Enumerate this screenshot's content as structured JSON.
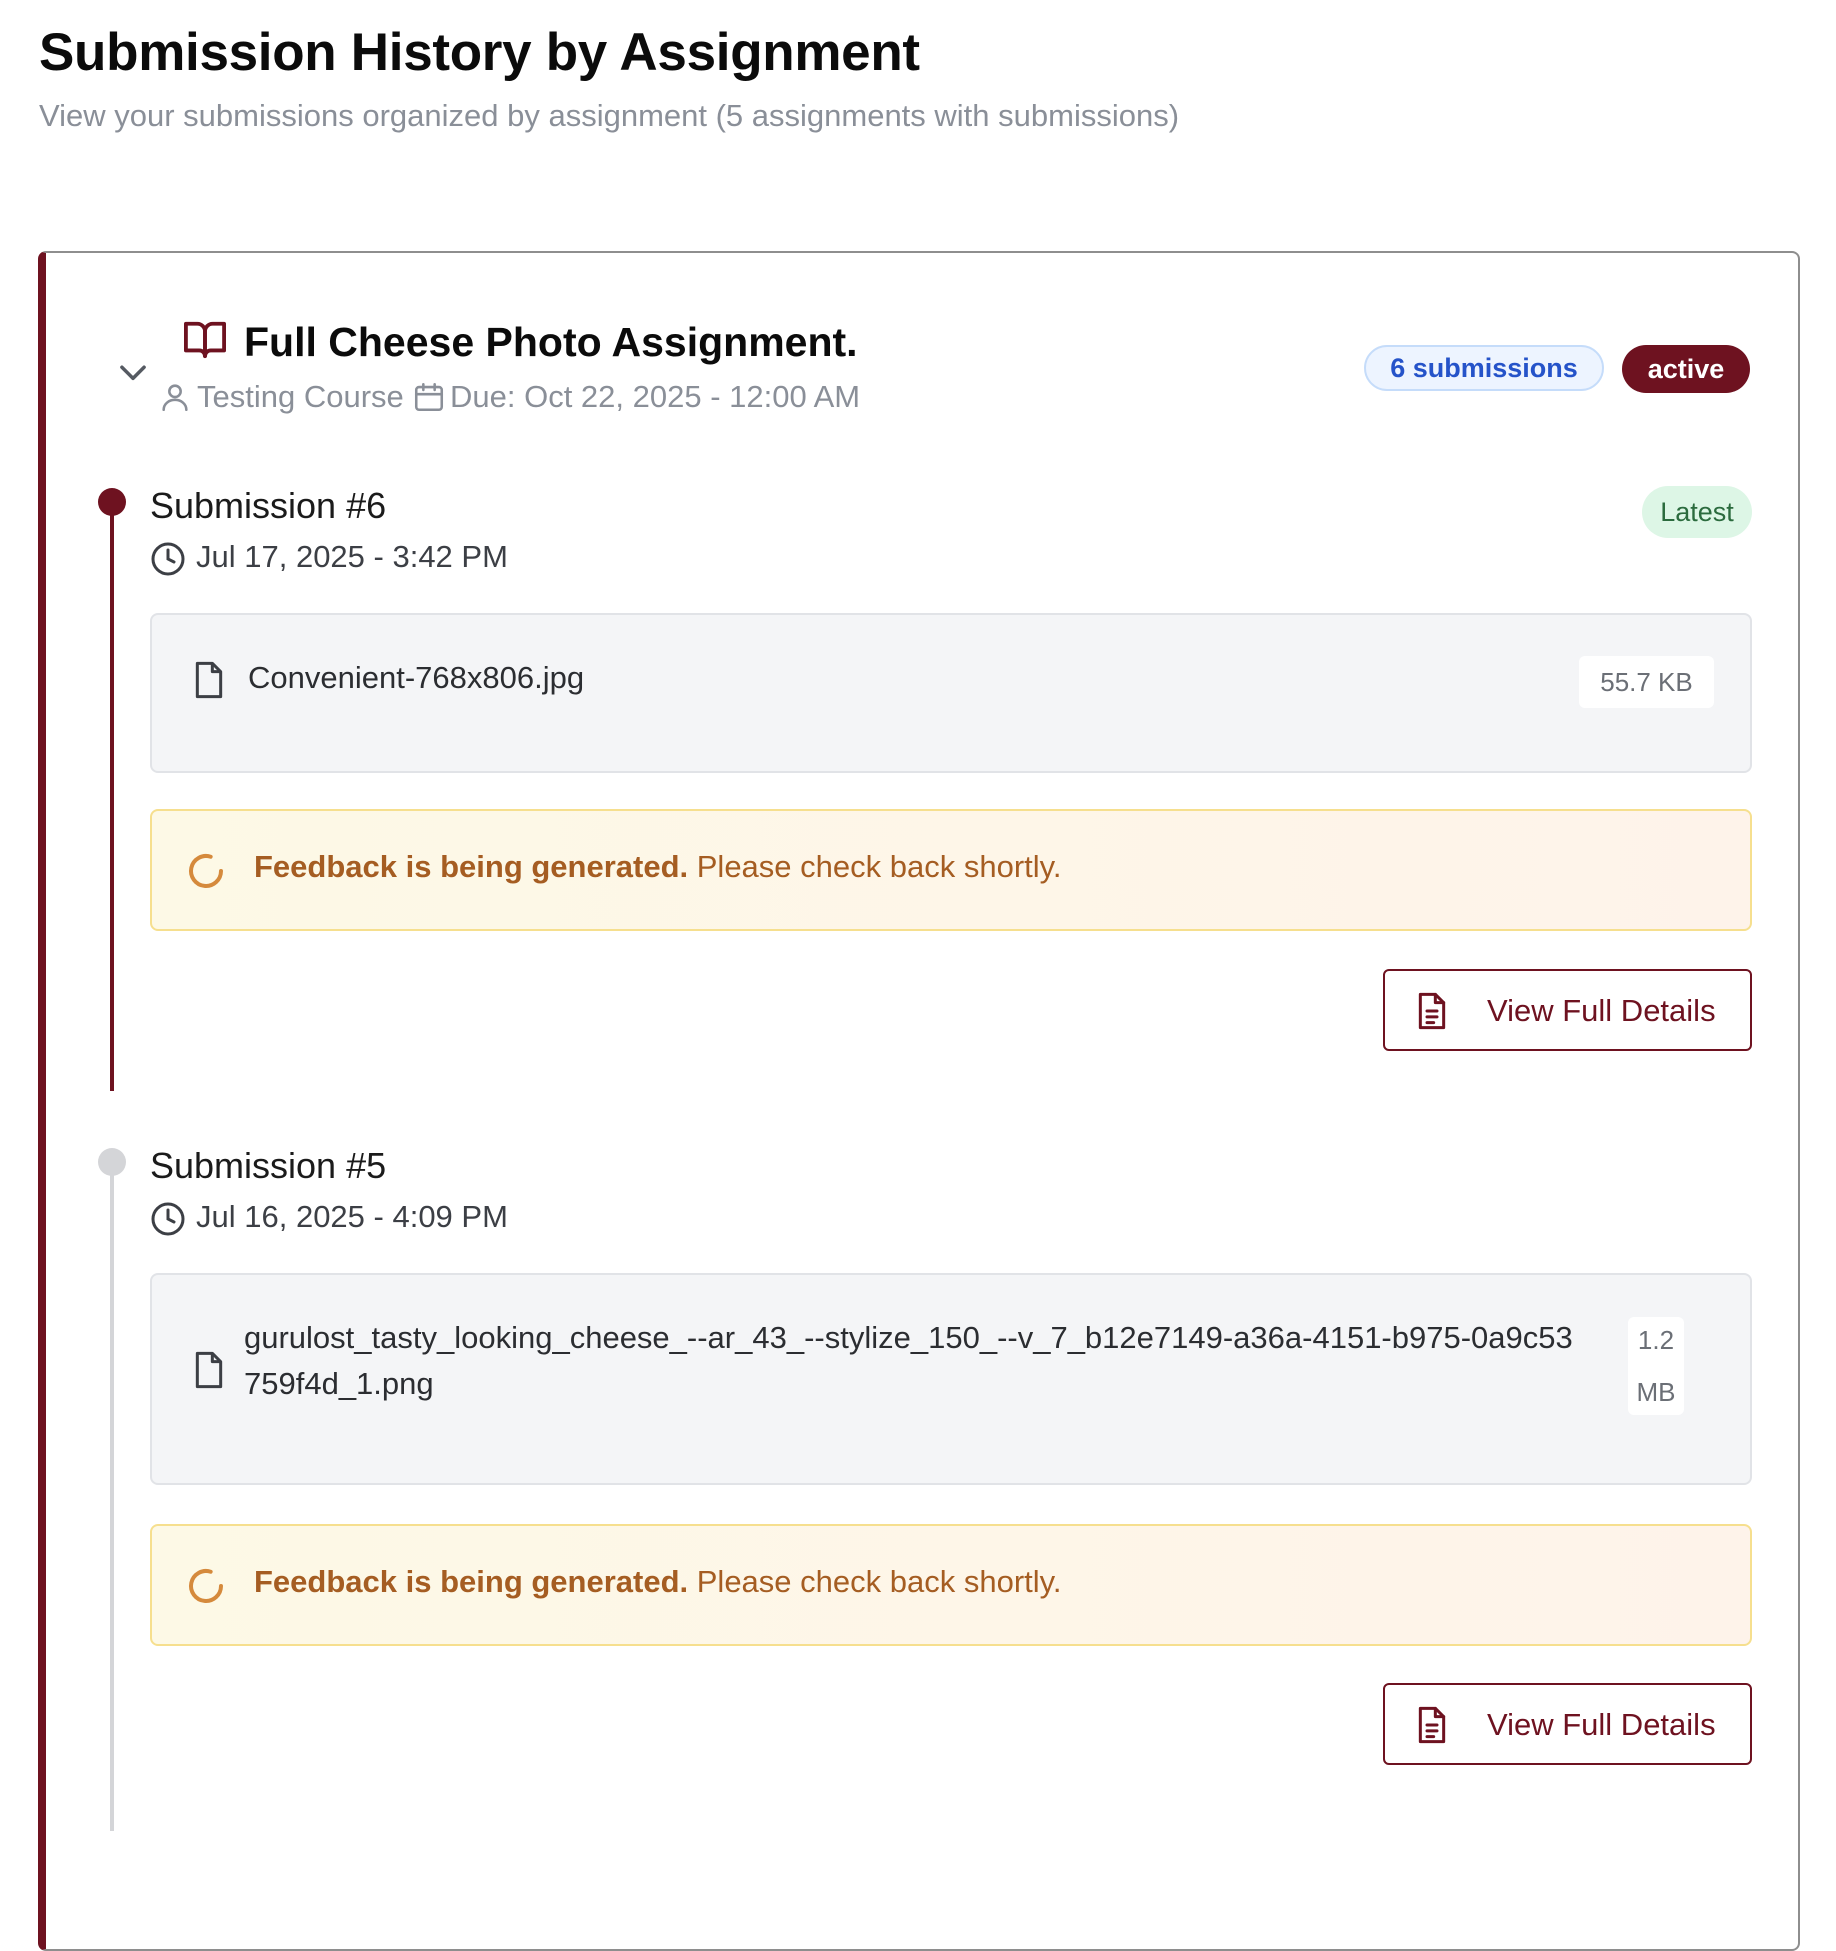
{
  "header": {
    "title": "Submission History by Assignment",
    "subtitle": "View your submissions organized by assignment (5 assignments with submissions)"
  },
  "assignment": {
    "title": "Full Cheese Photo Assignment.",
    "course": "Testing Course",
    "due": "Due: Oct 22, 2025 - 12:00 AM",
    "submissions_badge": "6 submissions",
    "status_badge": "active",
    "icons": {
      "toggle": "chevron-down-icon",
      "assignment": "book-open-icon",
      "course": "user-icon",
      "due": "calendar-icon"
    }
  },
  "submissions": [
    {
      "title": "Submission #6",
      "date": "Jul 17, 2025 - 3:42 PM",
      "latest_label": "Latest",
      "file": {
        "name": "Convenient-768x806.jpg",
        "size": "55.7 KB"
      },
      "feedback": {
        "bold": "Feedback is being generated.",
        "rest": " Please check back shortly."
      },
      "button_label": "View Full Details"
    },
    {
      "title": "Submission #5",
      "date": "Jul 16, 2025 - 4:09 PM",
      "file": {
        "name": "gurulost_tasty_looking_cheese_--ar_43_--stylize_150_--v_7_b12e7149-a36a-4151-b975-0a9c53759f4d_1.png",
        "size": "1.2 MB"
      },
      "feedback": {
        "bold": "Feedback is being generated.",
        "rest": " Please check back shortly."
      },
      "button_label": "View Full Details"
    }
  ],
  "colors": {
    "brand": "#6e1220",
    "latest_bg": "#ddf6e6",
    "feedback_text": "#a55d22",
    "count_badge": "#2553c9",
    "timeline_inactive": "#d4d5d8"
  }
}
